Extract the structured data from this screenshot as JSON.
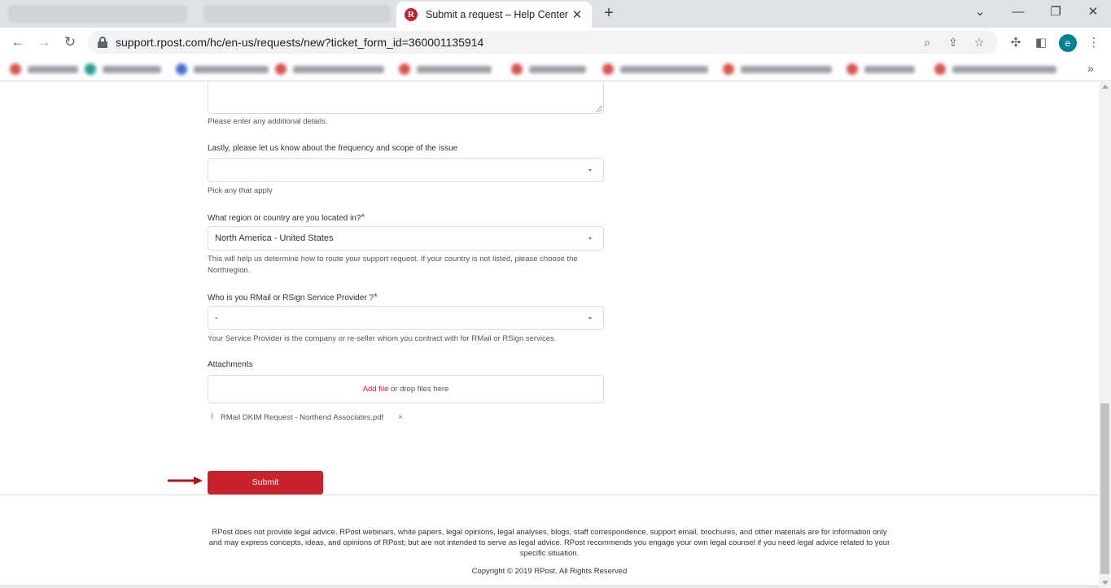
{
  "browser": {
    "tab_title": "Submit a request – Help Center",
    "tab_favicon_letter": "R",
    "url": "support.rpost.com/hc/en-us/requests/new?ticket_form_id=360001135914",
    "avatar_letter": "e",
    "colors": {
      "brand": "#c8232c",
      "avatar": "#00838f"
    }
  },
  "form": {
    "details_hint": "Please enter any additional details.",
    "frequency": {
      "label": "Lastly, please let us know about the frequency and scope of the issue",
      "value": "",
      "hint": "Pick any that apply"
    },
    "region": {
      "label": "What region or country are you located in?",
      "required_mark": "*",
      "value": "North America - United States",
      "hint": "This will help us determine how to route your support request. If your country is not listed, please choose the Northregion."
    },
    "provider": {
      "label": "Who is you RMail or RSign Service Provider ?",
      "required_mark": "*",
      "value": "-",
      "hint": "Your Service Provider is the company or re-seller whom you contract with for RMail or RSign services."
    },
    "attachments": {
      "label": "Attachments",
      "add_file": "Add file",
      "drop_text": " or drop files here",
      "files": [
        {
          "name": "RMail DKIM Request - Northend Associates.pdf",
          "remove": "×"
        }
      ]
    },
    "submit_label": "Submit"
  },
  "footer": {
    "disclaimer": "RPost does not provide legal advice. RPost webinars, white papers, legal opinions, legal analyses, blogs, staff correspondence, support email, brochures, and other materials are for information only and may express concepts, ideas, and opinions of RPost; but are not intended to serve as legal advice. RPost recommends you engage your own legal counsel if you need legal advice related to your specific situation.",
    "copyright": "Copyright © 2019 RPost. All Rights Reserved"
  }
}
